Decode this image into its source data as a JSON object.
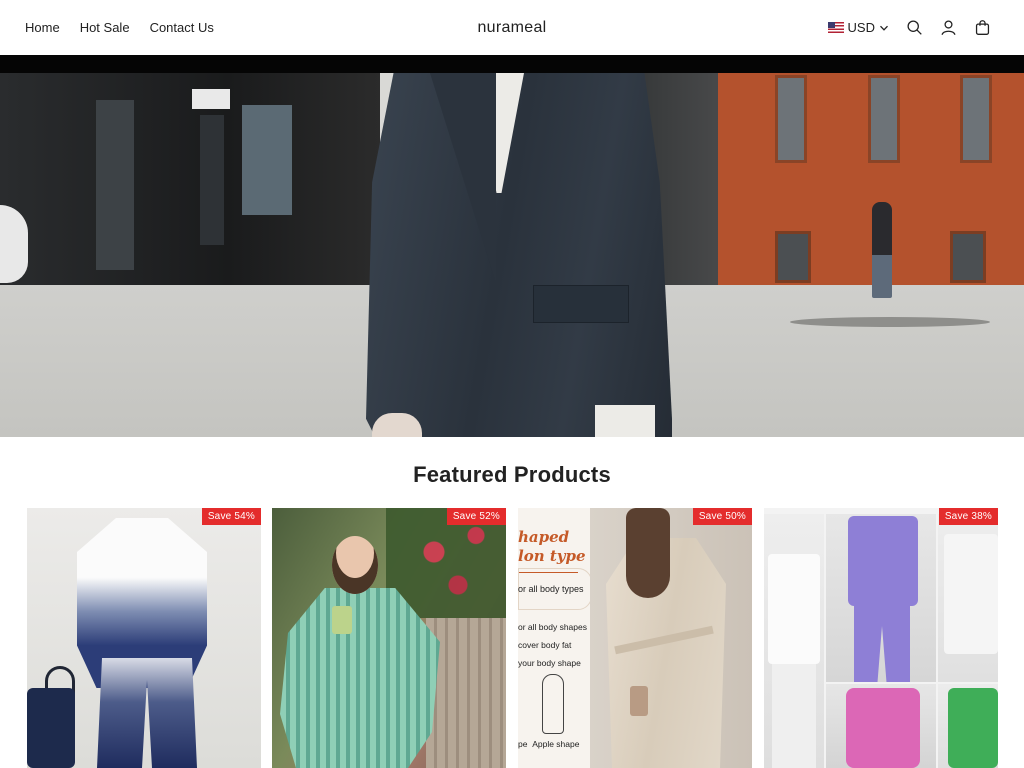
{
  "header": {
    "nav": [
      "Home",
      "Hot Sale",
      "Contact Us"
    ],
    "brand": "nurameal",
    "currency": "USD",
    "icons": [
      "search-icon",
      "account-icon",
      "cart-icon",
      "chevron-down-icon",
      "us-flag-icon"
    ]
  },
  "featured": {
    "title": "Featured Products",
    "products": [
      {
        "badge": "Save 54%"
      },
      {
        "badge": "Save 52%"
      },
      {
        "badge": "Save 50%",
        "image_text": {
          "heading": [
            "haped",
            "lon type"
          ],
          "subtitle": "or all body types",
          "list": [
            "or all body shapes",
            "cover body fat",
            "your body shape"
          ],
          "shape": "Apple shape",
          "shape_prefix": "pe"
        }
      },
      {
        "badge": "Save 38%"
      }
    ]
  },
  "colors": {
    "badge": "#e42c2c",
    "text": "#222222",
    "accent_orange": "#c55a28"
  }
}
